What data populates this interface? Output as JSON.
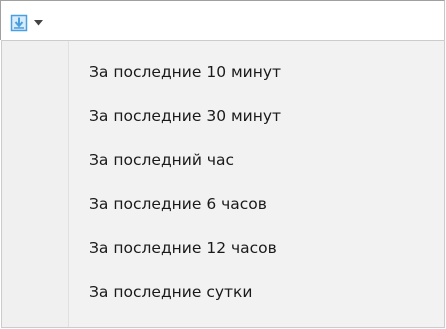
{
  "toolbar": {
    "download_button_icon": "download-icon",
    "dropdown_arrow_icon": "chevron-down-icon",
    "accent_color": "#4a9fe0"
  },
  "menu": {
    "items": [
      {
        "label": "За последние 10 минут"
      },
      {
        "label": "За последние 30 минут"
      },
      {
        "label": "За последний час"
      },
      {
        "label": "За последние 6 часов"
      },
      {
        "label": "За последние 12 часов"
      },
      {
        "label": "За последние сутки"
      }
    ]
  }
}
